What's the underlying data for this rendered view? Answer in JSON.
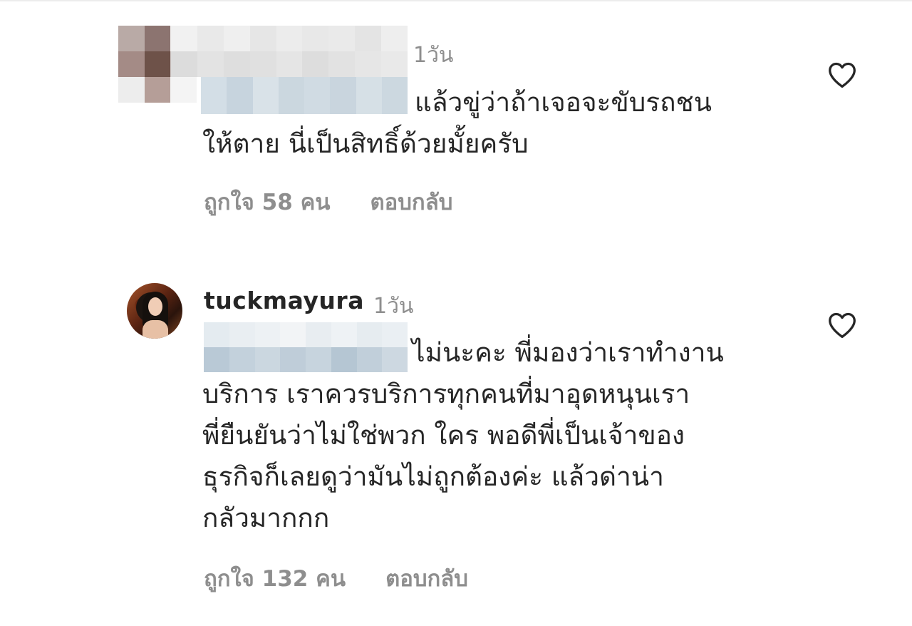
{
  "comments": [
    {
      "username": "",
      "time": "1วัน",
      "text": "แล้วขู่ว่าถ้าเจอจะขับรถชน\nให้ตาย นี่เป็นสิทธิ์ด้วยมั้ยครับ",
      "likes": "ถูกใจ 58 คน",
      "reply": "ตอบกลับ",
      "like_icon": "heart-outline-icon"
    },
    {
      "username": "tuckmayura",
      "time": "1วัน",
      "text": "ไม่นะคะ พี่มองว่าเราทำงาน\nบริการ เราควรบริการทุกคนที่มาอุดหนุนเรา\nพี่ยืนยันว่าไม่ใช่พวก ใคร พอดีพี่เป็นเจ้าของ\nธุรกิจก็เลยดูว่ามันไม่ถูกต้องค่ะ แล้วด่าน่า\nกลัวมากกก",
      "likes": "ถูกใจ 132 คน",
      "reply": "ตอบกลับ",
      "like_icon": "heart-outline-icon"
    }
  ],
  "colors": {
    "text": "#262626",
    "secondary": "#8e8e8e",
    "background": "#ffffff"
  }
}
